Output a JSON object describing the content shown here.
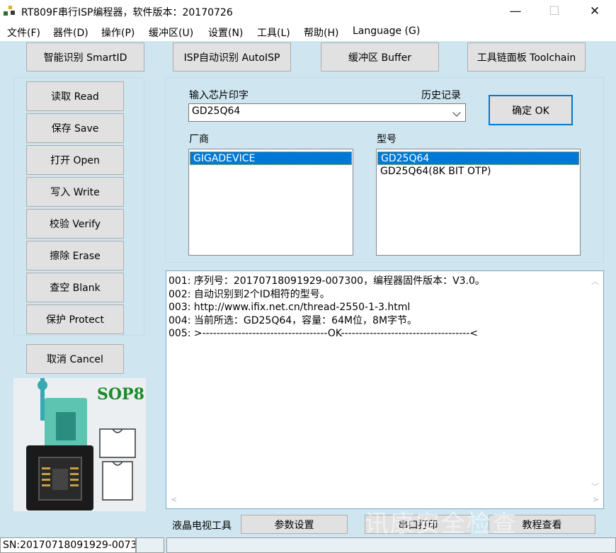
{
  "window": {
    "title": "RT809F串行ISP编程器，软件版本：20170726",
    "controls": [
      "—",
      "☐",
      "✕"
    ]
  },
  "menu": [
    "文件(F)",
    "器件(D)",
    "操作(P)",
    "缓冲区(U)",
    "设置(N)",
    "工具(L)",
    "帮助(H)",
    "Language (G)"
  ],
  "top_buttons": [
    "智能识别 SmartID",
    "ISP自动识别 AutoISP",
    "缓冲区 Buffer",
    "工具链面板 Toolchain"
  ],
  "side_buttons": [
    "读取 Read",
    "保存 Save",
    "打开 Open",
    "写入 Write",
    "校验 Verify",
    "擦除 Erase",
    "查空 Blank",
    "保护 Protect"
  ],
  "cancel_button": "取消 Cancel",
  "chip_form": {
    "input_label": "输入芯片印字",
    "history_label": "历史记录",
    "input_value": "GD25Q64",
    "ok_button": "确定 OK",
    "vendor_label": "厂商",
    "model_label": "型号",
    "vendors": [
      "GIGADEVICE"
    ],
    "models": [
      "GD25Q64",
      "GD25Q64(8K BIT OTP)"
    ]
  },
  "log": [
    "001: 序列号：20170718091929-007300，编程器固件版本：V3.0。",
    "002: 自动识别到2个ID相符的型号。",
    "003: http://www.ifix.net.cn/thread-2550-1-3.html",
    "004: 当前所选：GD25Q64，容量：64M位，8M字节。",
    "005: >-----------------------------------OK------------------------------------<"
  ],
  "socket_image": {
    "label": "SOP8",
    "label_color": "#1a8a2a"
  },
  "bottom_bar": {
    "tool_label": "液晶电视工具",
    "buttons": [
      "参数设置",
      "串口打印",
      "教程查看"
    ]
  },
  "status": {
    "sn": "SN:20170718091929-0073"
  },
  "watermark": "讯康安全检查",
  "colors": {
    "background": "#cfe6f1",
    "selection": "#0078d7",
    "button_face": "#e1e1e1"
  }
}
